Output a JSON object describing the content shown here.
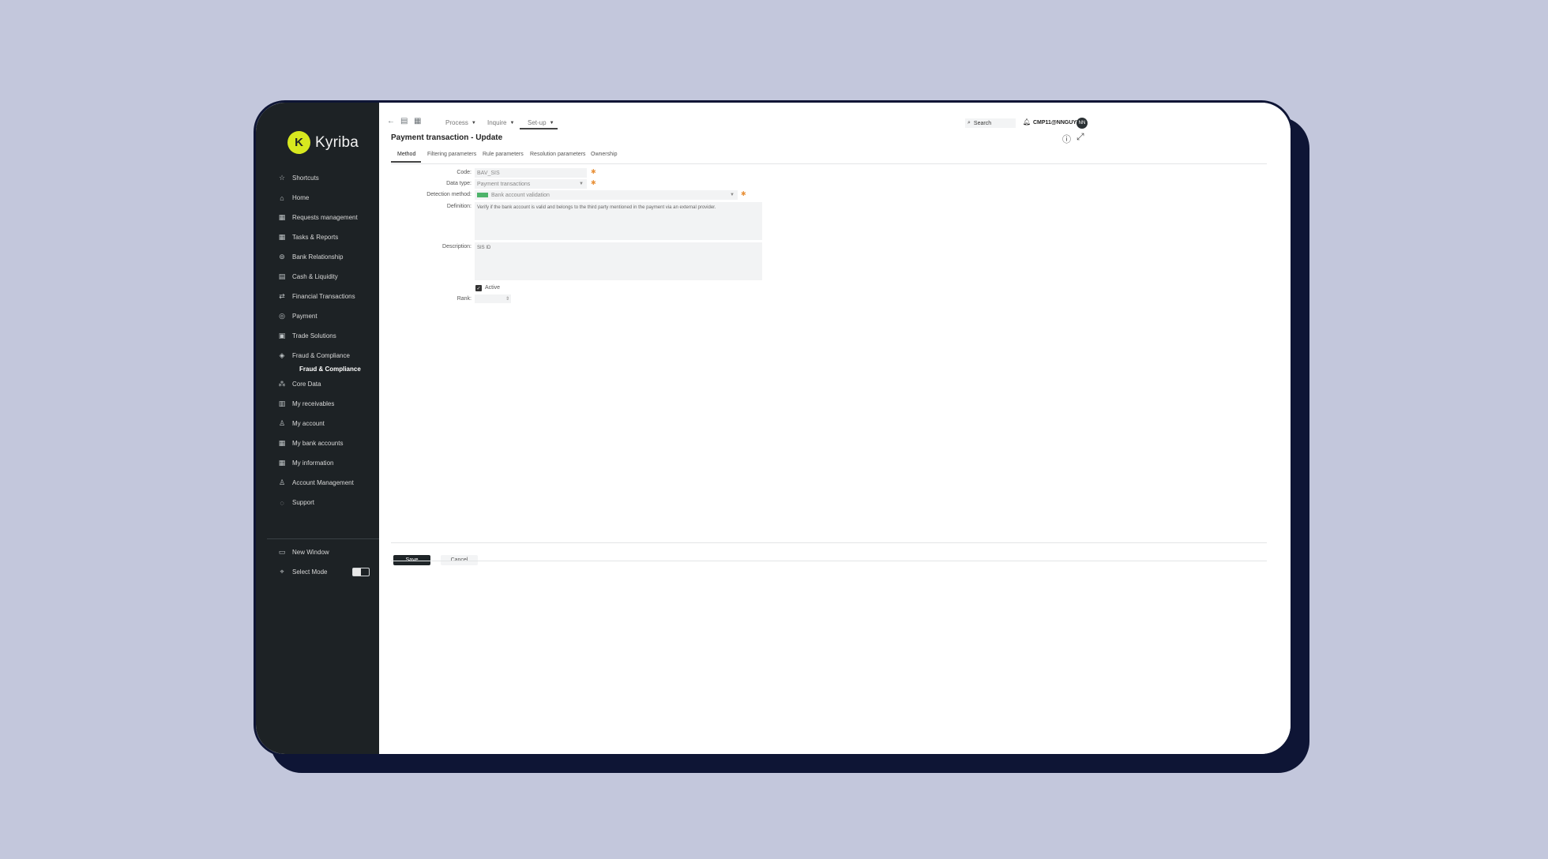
{
  "brand": {
    "name": "Kyriba"
  },
  "sidebar": {
    "items": [
      {
        "label": "Shortcuts",
        "icon": "star-icon"
      },
      {
        "label": "Home",
        "icon": "home-icon"
      },
      {
        "label": "Requests management",
        "icon": "calendar-icon"
      },
      {
        "label": "Tasks & Reports",
        "icon": "calendar-icon"
      },
      {
        "label": "Bank Relationship",
        "icon": "bank-icon"
      },
      {
        "label": "Cash & Liquidity",
        "icon": "cash-icon"
      },
      {
        "label": "Financial Transactions",
        "icon": "transfer-icon"
      },
      {
        "label": "Payment",
        "icon": "payment-icon"
      },
      {
        "label": "Trade Solutions",
        "icon": "document-icon"
      },
      {
        "label": "Fraud & Compliance",
        "icon": "shield-icon"
      }
    ],
    "sub_item": "Fraud & Compliance",
    "items_after": [
      {
        "label": "Core Data",
        "icon": "hierarchy-icon"
      },
      {
        "label": "My receivables",
        "icon": "receivables-icon"
      },
      {
        "label": "My account",
        "icon": "user-icon"
      },
      {
        "label": "My bank accounts",
        "icon": "grid-icon"
      },
      {
        "label": "My information",
        "icon": "grid-icon"
      },
      {
        "label": "Account Management",
        "icon": "user-icon"
      },
      {
        "label": "Support",
        "icon": "support-icon"
      }
    ],
    "bottom": [
      {
        "label": "New Window",
        "icon": "window-icon"
      },
      {
        "label": "Select Mode",
        "icon": "cursor-icon"
      }
    ]
  },
  "topbar": {
    "menus": [
      "Process",
      "Inquire",
      "Set-up"
    ],
    "active_menu": "Set-up",
    "search_label": "Search",
    "user_name": "CMP11@NNGUYEN",
    "avatar_initials": "NN"
  },
  "page": {
    "title": "Payment transaction - Update"
  },
  "tabs": [
    "Method",
    "Filtering parameters",
    "Rule parameters",
    "Resolution parameters",
    "Ownership"
  ],
  "form": {
    "code_label": "Code:",
    "code_value": "BAV_SIS",
    "data_type_label": "Data type:",
    "data_type_value": "Payment transactions",
    "detection_label": "Detection method:",
    "detection_value": "Bank account validation",
    "definition_label": "Definition:",
    "definition_value": "Verify if the bank account is valid and belongs to the third party mentioned in the payment via an external provider.",
    "description_label": "Description:",
    "description_value": "SIS ID",
    "active_label": "Active",
    "rank_label": "Rank:"
  },
  "buttons": {
    "save": "Save",
    "cancel": "Cancel"
  },
  "colors": {
    "sidebar_bg": "#1d2225",
    "brand_accent": "#d7e81f",
    "required": "#e8913a",
    "chip": "#4db36a",
    "frame_bg": "#c3c7dc",
    "device_shadow": "#0e1535"
  }
}
